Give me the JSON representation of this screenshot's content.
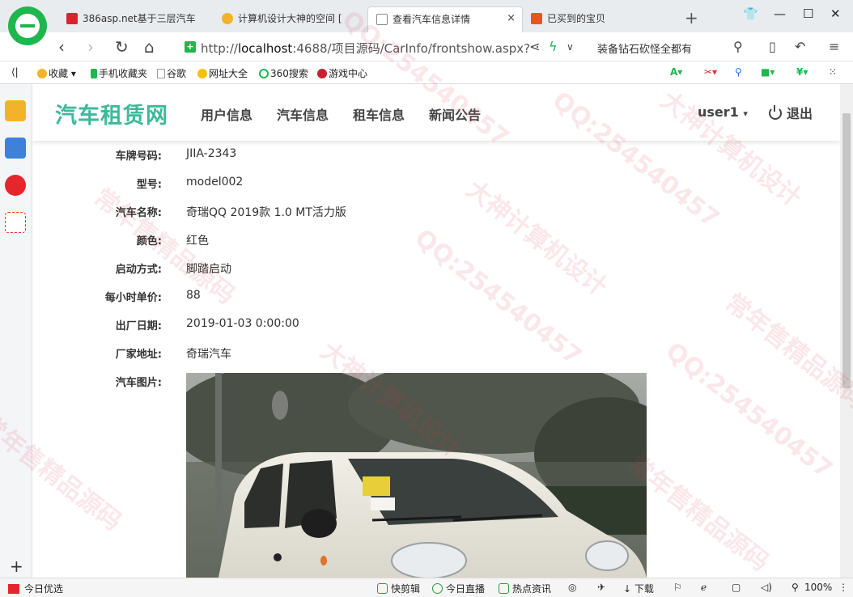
{
  "browser": {
    "tabs": [
      {
        "label": "386asp.net基于三层汽车",
        "color": "#d9232d"
      },
      {
        "label": "计算机设计大神的空间 [",
        "color": "#f2b32a"
      },
      {
        "label": "查看汽车信息详情",
        "color": "#ffffff"
      },
      {
        "label": "已买到的宝贝",
        "color": "#e8561e"
      }
    ],
    "close_glyph": "×",
    "new_tab_glyph": "+",
    "url_prefix": "http://",
    "url_host": "localhost",
    "url_rest": ":4688/项目源码/CarInfo/frontshow.aspx?",
    "search_hint": "装备钻石砍怪全都有",
    "bookmarks": [
      "收藏",
      "手机收藏夹",
      "谷歌",
      "网址大全",
      "360搜索",
      "游戏中心"
    ],
    "zoom": "100%"
  },
  "site": {
    "brand": "汽车租赁网",
    "menu": [
      "用户信息",
      "汽车信息",
      "租车信息",
      "新闻公告"
    ],
    "user": "user1",
    "logout": "退出"
  },
  "car": {
    "fields": [
      {
        "label": "车牌号码:",
        "value": "JIIA-2343"
      },
      {
        "label": "型号:",
        "value": "model002"
      },
      {
        "label": "汽车名称:",
        "value": "奇瑞QQ 2019款 1.0 MT活力版"
      },
      {
        "label": "颜色:",
        "value": "红色"
      },
      {
        "label": "启动方式:",
        "value": "脚踏启动"
      },
      {
        "label": "每小时单价:",
        "value": "88"
      },
      {
        "label": "出厂日期:",
        "value": "2019-01-03 0:00:00"
      },
      {
        "label": "厂家地址:",
        "value": "奇瑞汽车"
      }
    ],
    "image_label": "汽车图片:"
  },
  "statusbar": {
    "left": "今日优选",
    "items": [
      "快剪辑",
      "今日直播",
      "热点资讯",
      "下载"
    ]
  },
  "watermark": {
    "qq": "QQ:254540457",
    "brand": "大神计算机设计",
    "slogan": "常年售精品源码"
  }
}
